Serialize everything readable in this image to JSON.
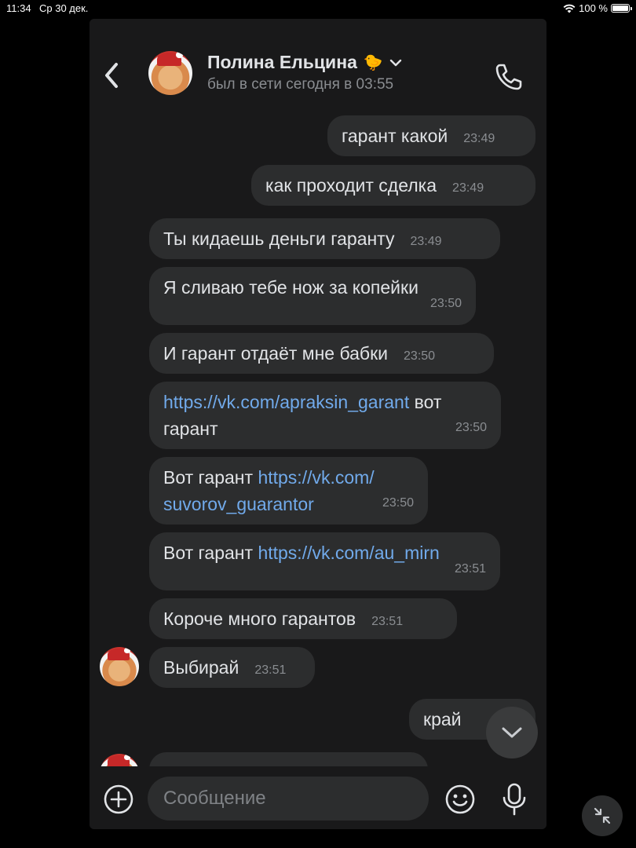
{
  "status_bar": {
    "time": "11:34",
    "date": "Ср 30 дек.",
    "battery": "100 %",
    "battery_level": 1.0,
    "wifi_icon": "wifi-icon"
  },
  "header": {
    "back_icon": "chevron-left-icon",
    "name": "Полина Ельцина",
    "emoji": "🐤",
    "dropdown_icon": "chevron-down-icon",
    "last_seen": "был в сети сегодня в 03:55",
    "call_icon": "phone-icon"
  },
  "messages": [
    {
      "dir": "out",
      "text": "гарант какой",
      "time": "23:49"
    },
    {
      "dir": "out",
      "text": "как проходит сделка",
      "time": "23:49"
    },
    {
      "dir": "in",
      "text": "Ты кидаешь деньги гаранту",
      "time": "23:49"
    },
    {
      "dir": "in",
      "text": "Я сливаю тебе нож за копейки",
      "time": "23:50"
    },
    {
      "dir": "in",
      "text": "И гарант отдаёт мне бабки",
      "time": "23:50"
    },
    {
      "dir": "in",
      "link": "https://vk.com/apraksin_garant",
      "text_after": " вот гарант",
      "time": "23:50"
    },
    {
      "dir": "in",
      "text_before": "Вот гарант ",
      "link_line1": "https://vk.com/",
      "link_line2": "suvorov_guarantor",
      "time": "23:50"
    },
    {
      "dir": "in",
      "text_before": "Вот гарант ",
      "link": "https://vk.com/au_mirn",
      "time": "23:51"
    },
    {
      "dir": "in",
      "text": "Короче много гарантов",
      "time": "23:51"
    },
    {
      "dir": "in",
      "text": "Выбирай",
      "time": "23:51"
    },
    {
      "dir": "out",
      "text": "край",
      "time": ""
    }
  ],
  "composer": {
    "add_icon": "plus-circle-icon",
    "placeholder": "Сообщение",
    "emoji_icon": "smile-icon",
    "mic_icon": "microphone-icon"
  },
  "scroll_down_icon": "chevron-down-icon",
  "collapse_icon": "collapse-arrows-icon"
}
